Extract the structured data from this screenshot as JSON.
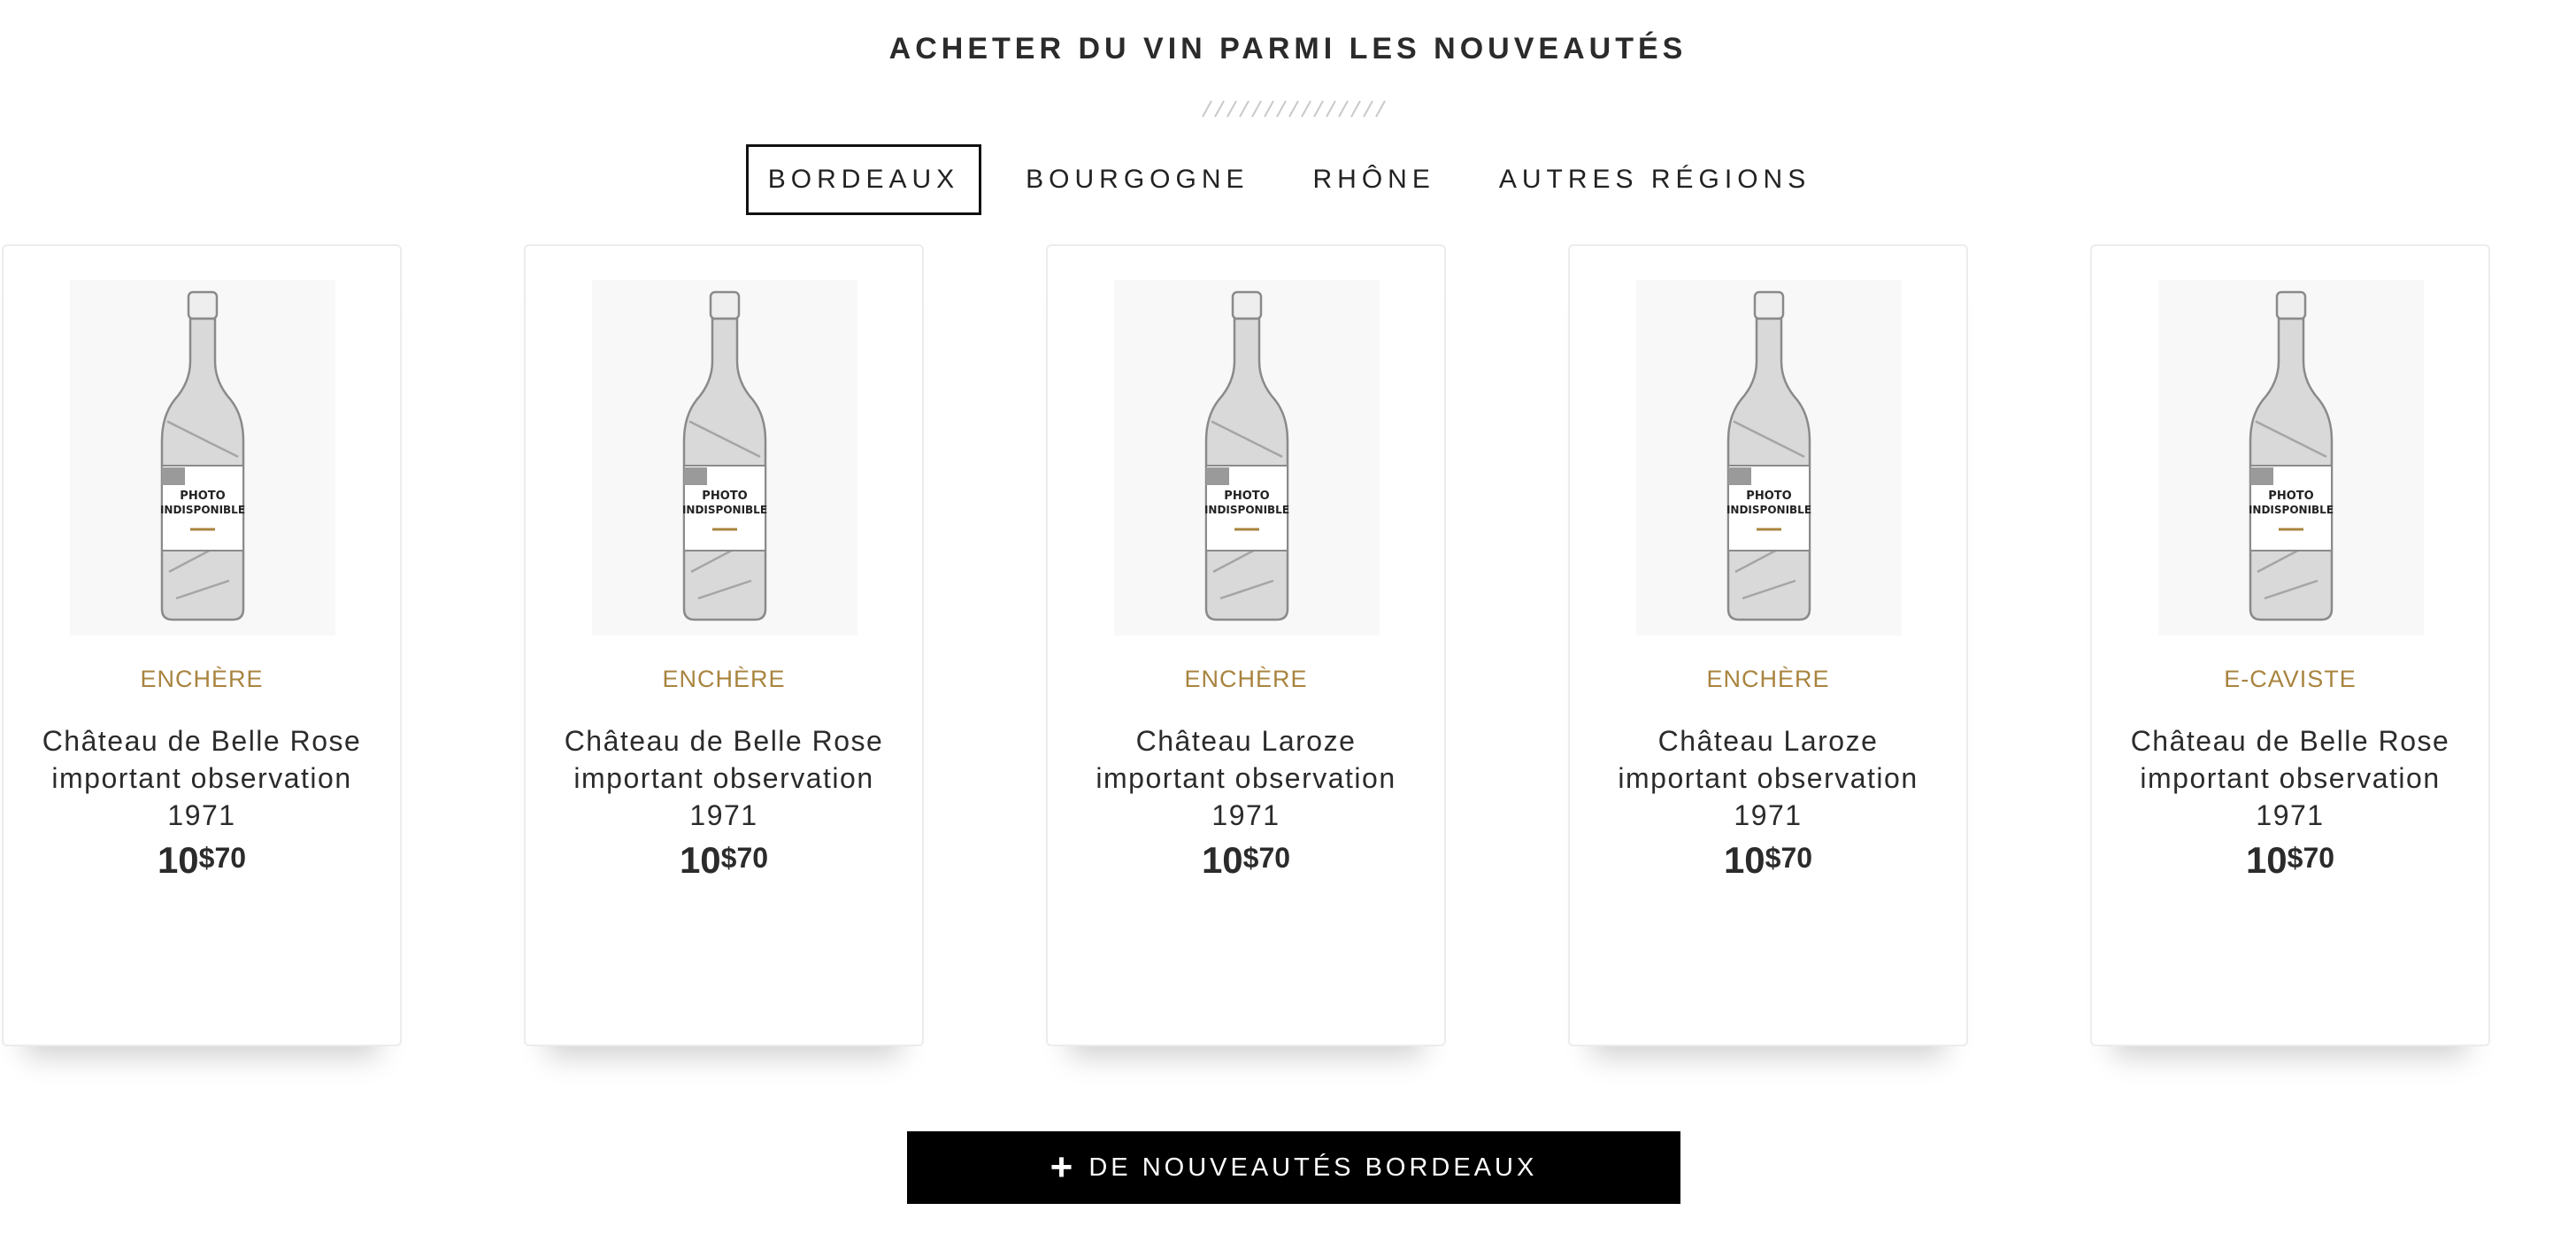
{
  "heading": "ACHETER DU VIN PARMI LES NOUVEAUTÉS",
  "tabs": [
    {
      "label": "BORDEAUX",
      "active": true
    },
    {
      "label": "BOURGOGNE",
      "active": false
    },
    {
      "label": "RHÔNE",
      "active": false
    },
    {
      "label": "AUTRES RÉGIONS",
      "active": false
    }
  ],
  "placeholder": {
    "line1": "PHOTO",
    "line2": "INDISPONIBLE"
  },
  "products": [
    {
      "type": "ENCHÈRE",
      "name_line1": "Château de Belle Rose",
      "name_line2": "important observation",
      "year": "1971",
      "price_int": "10",
      "price_currency": "$",
      "price_dec": "70"
    },
    {
      "type": "ENCHÈRE",
      "name_line1": "Château de Belle Rose",
      "name_line2": "important observation",
      "year": "1971",
      "price_int": "10",
      "price_currency": "$",
      "price_dec": "70"
    },
    {
      "type": "ENCHÈRE",
      "name_line1": "Château Laroze",
      "name_line2": "important observation",
      "year": "1971",
      "price_int": "10",
      "price_currency": "$",
      "price_dec": "70"
    },
    {
      "type": "ENCHÈRE",
      "name_line1": "Château Laroze",
      "name_line2": "important observation",
      "year": "1971",
      "price_int": "10",
      "price_currency": "$",
      "price_dec": "70"
    },
    {
      "type": "E-CAVISTE",
      "name_line1": "Château de Belle Rose",
      "name_line2": "important observation",
      "year": "1971",
      "price_int": "10",
      "price_currency": "$",
      "price_dec": "70"
    }
  ],
  "cta": {
    "icon": "plus-icon",
    "label": "DE NOUVEAUTÉS BORDEAUX"
  },
  "colors": {
    "accent": "#a8843f",
    "text": "#2b2b2b",
    "cta_bg": "#000000"
  }
}
